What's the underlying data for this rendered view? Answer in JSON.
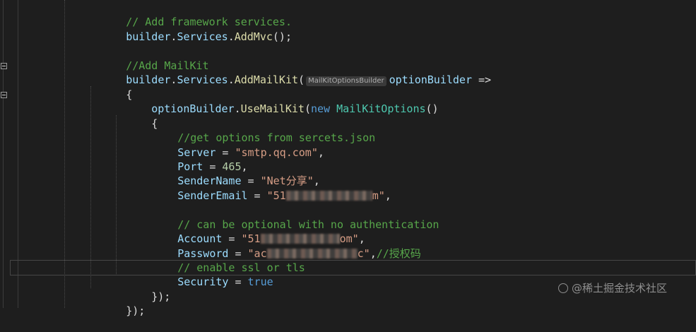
{
  "editor": {
    "lines": {
      "l1_comment": "// Add framework services.",
      "l2_builder": "builder",
      "l2_services": "Services",
      "l2_method": "AddMvc",
      "l2_tail": "();",
      "l4_comment": "//Add MailKit",
      "l5_builder": "builder",
      "l5_services": "Services",
      "l5_method": "AddMailKit",
      "l5_hint": "MailKitOptionsBuilder",
      "l5_param": "optionBuilder",
      "l5_arrow": "=>",
      "l6_brace": "{",
      "l7_obj": "optionBuilder",
      "l7_method": "UseMailKit",
      "l7_new": "new",
      "l7_type": "MailKitOptions",
      "l7_tail": "()",
      "l8_brace": "{",
      "l9_comment": "//get options from sercets.json",
      "l10_prop": "Server",
      "l10_value": "\"smtp.qq.com\"",
      "l11_prop": "Port",
      "l11_value": "465",
      "l12_prop": "SenderName",
      "l12_value": "\"Net分享\"",
      "l13_prop": "SenderEmail",
      "l13_value_start": "\"51",
      "l13_value_end": "m\"",
      "l15_comment": "// can be optional with no authentication",
      "l16_prop": "Account",
      "l16_value_start": "\"51",
      "l16_value_end": "om\"",
      "l17_prop": "Password",
      "l17_value_start": "\"ac",
      "l17_value_end": "c\"",
      "l17_comment": "//授权码",
      "l18_comment": "// enable ssl or tls",
      "l19_prop": "Security",
      "l19_value": "true",
      "l20_close": "});",
      "l21_close": "});"
    }
  },
  "watermark": {
    "text": "@稀土掘金技术社区"
  },
  "colors": {
    "background": "#1e1e1e",
    "comment": "#57a64a",
    "identifier": "#9cdcfe",
    "method": "#dcdcaa",
    "keyword": "#569cd6",
    "type": "#4ec9b0",
    "string": "#d69d85",
    "number": "#b5cea8"
  }
}
